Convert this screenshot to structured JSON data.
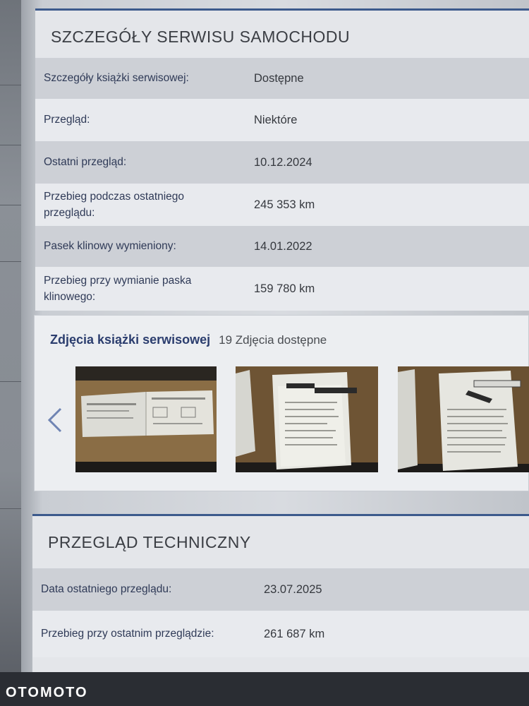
{
  "service": {
    "title": "SZCZEGÓŁY SERWISU SAMOCHODU",
    "rows": [
      {
        "label": "Szczegóły książki serwisowej:",
        "value": "Dostępne"
      },
      {
        "label": "Przegląd:",
        "value": "Niektóre"
      },
      {
        "label": "Ostatni przegląd:",
        "value": "10.12.2024"
      },
      {
        "label": "Przebieg podczas ostatniego przeglądu:",
        "value": "245 353 km"
      },
      {
        "label": "Pasek klinowy wymieniony:",
        "value": "14.01.2022"
      },
      {
        "label": "Przebieg przy wymianie paska klinowego:",
        "value": "159 780 km"
      }
    ]
  },
  "photos": {
    "title": "Zdjęcia książki serwisowej",
    "count": "19 Zdjęcia dostępne",
    "prev_icon": "chevron-left-icon"
  },
  "inspection": {
    "title": "PRZEGLĄD TECHNICZNY",
    "rows": [
      {
        "label": "Data ostatniego przeglądu:",
        "value": "23.07.2025"
      },
      {
        "label": "Przebieg przy ostatnim przeglądzie:",
        "value": "261 687 km"
      }
    ]
  },
  "watermark": "OTOMOTO",
  "colors": {
    "accent": "#3c5a8c",
    "label_text": "#2f3a57",
    "row_shade": "#cdd0d6",
    "row_light": "#e8eaee"
  }
}
